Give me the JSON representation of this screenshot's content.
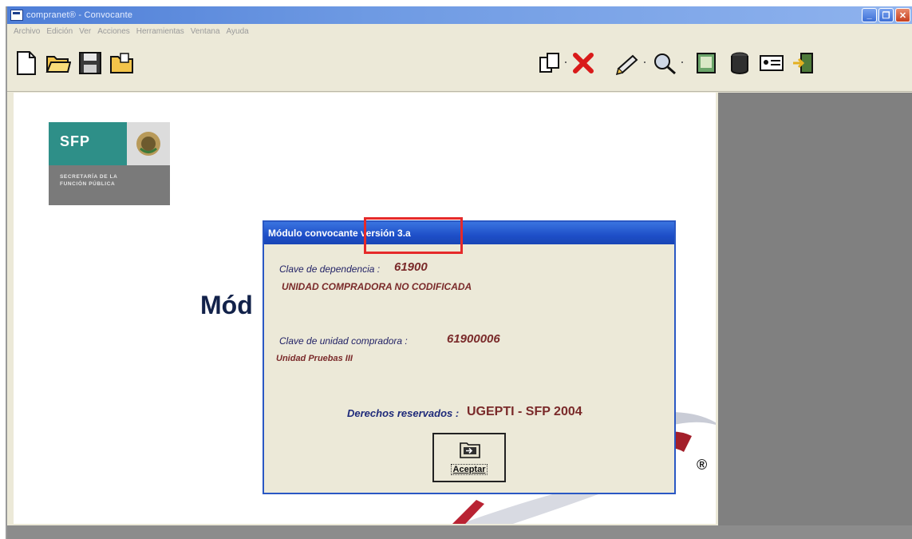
{
  "window": {
    "title": "compranet® - Convocante"
  },
  "menu": [
    "Archivo",
    "Edición",
    "Ver",
    "Acciones",
    "Herramientas",
    "Ventana",
    "Ayuda"
  ],
  "toolbar": {
    "left_icons": [
      "new-document-icon",
      "open-folder-icon",
      "save-disk-icon",
      "open-file-icon"
    ],
    "right_icons": [
      "copy-pages-icon",
      "delete-x-icon",
      "edit-pen-icon",
      "search-magnifier-icon",
      "report-book-icon",
      "database-icon",
      "id-card-icon",
      "exit-door-icon"
    ]
  },
  "background": {
    "logo_text": "SFP",
    "logo_sub_line1": "SECRETARÍA DE LA",
    "logo_sub_line2": "FUNCIÓN PÚBLICA",
    "partial_title": "Mód",
    "registered_mark": "®"
  },
  "dialog": {
    "title": "Módulo convocante versión 3.a",
    "dependencia_label": "Clave de dependencia :",
    "dependencia_value": "61900",
    "dependencia_name": "UNIDAD COMPRADORA NO CODIFICADA",
    "unidad_label": "Clave de unidad compradora :",
    "unidad_value": "61900006",
    "unidad_name": "Unidad Pruebas III",
    "copyright_label": "Derechos reservados :",
    "copyright_value": "UGEPTI - SFP  2004",
    "accept_label": "Aceptar"
  },
  "colors": {
    "titlebar": "#4e7ed7",
    "dialog_title": "#1e4fc8",
    "highlight": "#e52a2a",
    "sfp_teal": "#2e8f88"
  }
}
